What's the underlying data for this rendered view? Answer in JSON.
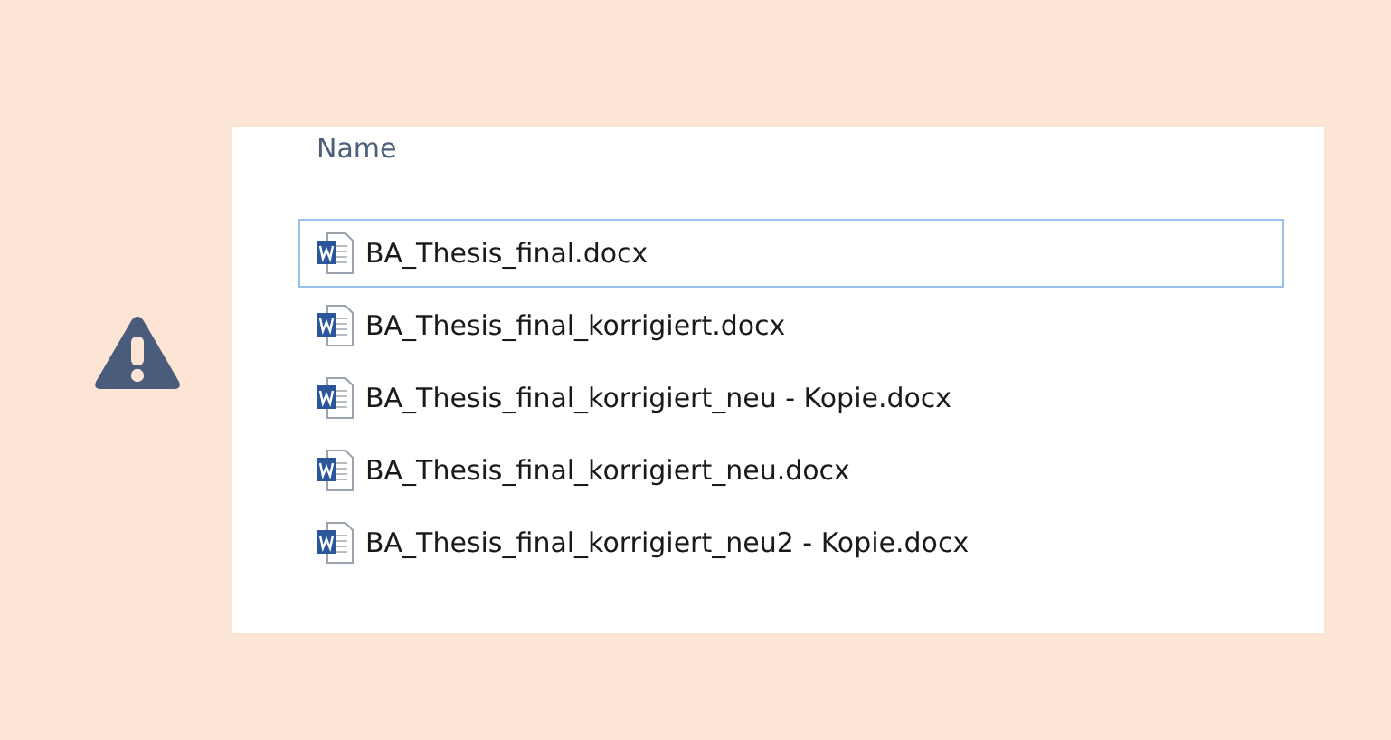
{
  "file_list": {
    "column_header": "Name",
    "files": [
      {
        "name": "BA_Thesis_final.docx",
        "selected": true
      },
      {
        "name": "BA_Thesis_final_korrigiert.docx",
        "selected": false
      },
      {
        "name": "BA_Thesis_final_korrigiert_neu - Kopie.docx",
        "selected": false
      },
      {
        "name": "BA_Thesis_final_korrigiert_neu.docx",
        "selected": false
      },
      {
        "name": "BA_Thesis_final_korrigiert_neu2 - Kopie.docx",
        "selected": false
      }
    ]
  }
}
